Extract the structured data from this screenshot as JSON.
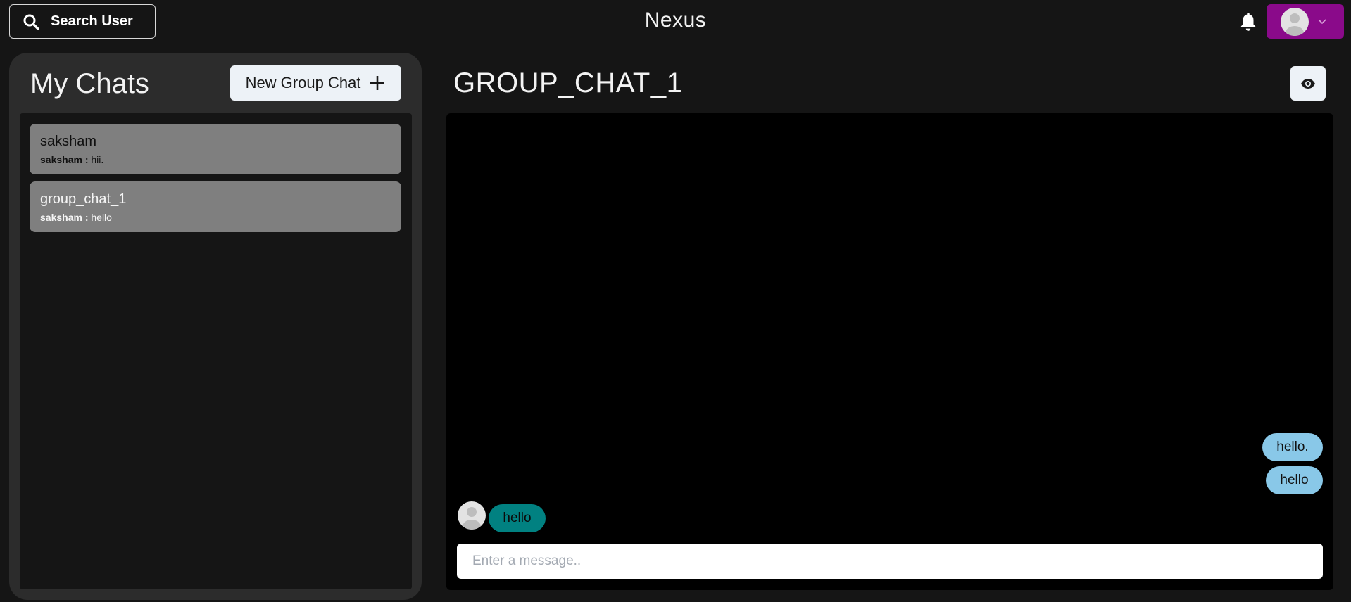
{
  "header": {
    "search_label": "Search User",
    "app_title": "Nexus",
    "icons": {
      "search": "search-icon",
      "notifications": "bell-icon",
      "profile": "user-avatar",
      "menu": "chevron-down-icon"
    },
    "profile_button_color": "#8a0a8a"
  },
  "sidebar": {
    "heading": "My Chats",
    "new_group_label": "New Group Chat",
    "chats": [
      {
        "name": "saksham",
        "last_sender": "saksham :",
        "last_message": "hii.",
        "active": false
      },
      {
        "name": "group_chat_1",
        "last_sender": "saksham :",
        "last_message": "hello",
        "active": true
      }
    ]
  },
  "conversation": {
    "title": "GROUP_CHAT_1",
    "view_button_icon": "eye-icon",
    "messages": [
      {
        "text": "hello.",
        "direction": "sent"
      },
      {
        "text": "hello",
        "direction": "sent"
      },
      {
        "text": "hello",
        "direction": "received"
      }
    ],
    "input_placeholder": "Enter a message.."
  },
  "colors": {
    "background": "#151515",
    "panel": "#2c2c2c",
    "chat_item": "#7f7f7f",
    "sent_bubble": "#89c8e8",
    "received_bubble": "#018181",
    "button_light": "#edf2f7"
  }
}
